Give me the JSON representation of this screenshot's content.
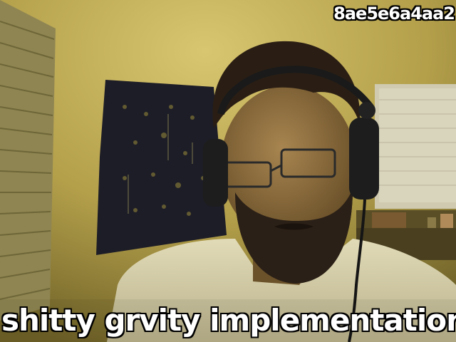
{
  "image": {
    "hash_label": "8ae5e6a4aa2",
    "caption": "shitty grvity implementation"
  },
  "colors": {
    "wall": "#c8b35a",
    "wall_shadow": "#7d6d2a",
    "tapestry": "#1c1c26",
    "shirt": "#d9d2ae",
    "hair": "#2a1e14",
    "skin": "#8a6a3e",
    "window": "#d6d2b4"
  }
}
